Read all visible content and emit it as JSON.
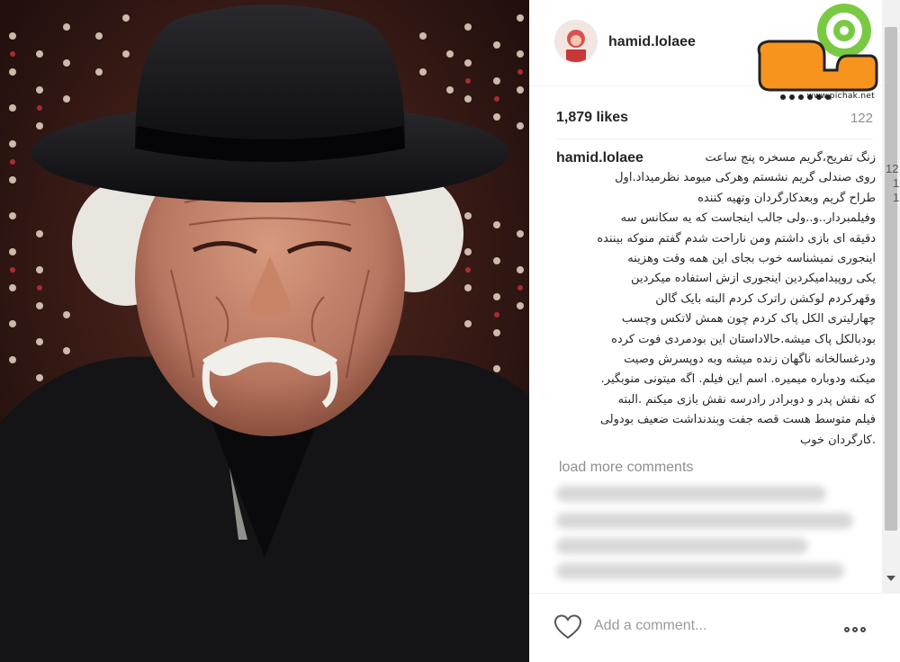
{
  "post": {
    "username": "hamid.lolaee",
    "likes": "1,879 likes",
    "count": "122",
    "caption": {
      "username": "hamid.lolaee",
      "lines": [
        "زنگ تفریح،گریم مسخره پنج ساعت",
        "روی صندلی گریم نشستم وهرکی میومد نظرمیداد.اول",
        "طراح گریم وبعدکارگردان وتهیه کننده",
        "وفیلمبردار..و..ولی جالب اینجاست که یه سکانس سه",
        "دقیقه ای بازی داشتم ومن ناراحت شدم گفتم منوکه بیننده",
        "اینجوری نمیشناسه خوب بجای این همه وقت وهزینه",
        "یکی روپیدامیکردین اینجوری ازش استفاده میکردین",
        "وقهرکردم لوکشن راترک کردم البته بایک گالن",
        "چهارلیتری الکل پاک کردم چون همش لاتکس وچسب",
        "بودبالکل پاک میشه.حالاداستان این بودمردی فوت کرده",
        "ودرغسالخانه ناگهان زنده میشه وبه دوپسرش وصیت",
        "میکنه ودوباره میمیره. اسم این فیلم. اگه میتونی منوبگیر.",
        "که نقش پدر و دوبرادر رادرسه نقش بازی میکنم .البته",
        "فیلم متوسط هست قصه جفت وبندنداشت ضعیف بودولی",
        ".کارگردان خوب"
      ]
    },
    "load_more": "load more comments",
    "comment_placeholder": "Add a comment...",
    "peek_numbers": [
      "12",
      "1",
      "1"
    ]
  },
  "watermark": {
    "site": "www.pichak.net"
  },
  "colors": {
    "text": "#262626",
    "muted": "#8e8e8e",
    "border": "#efefef"
  },
  "icons": [
    "heart-icon",
    "more-options-icon"
  ]
}
